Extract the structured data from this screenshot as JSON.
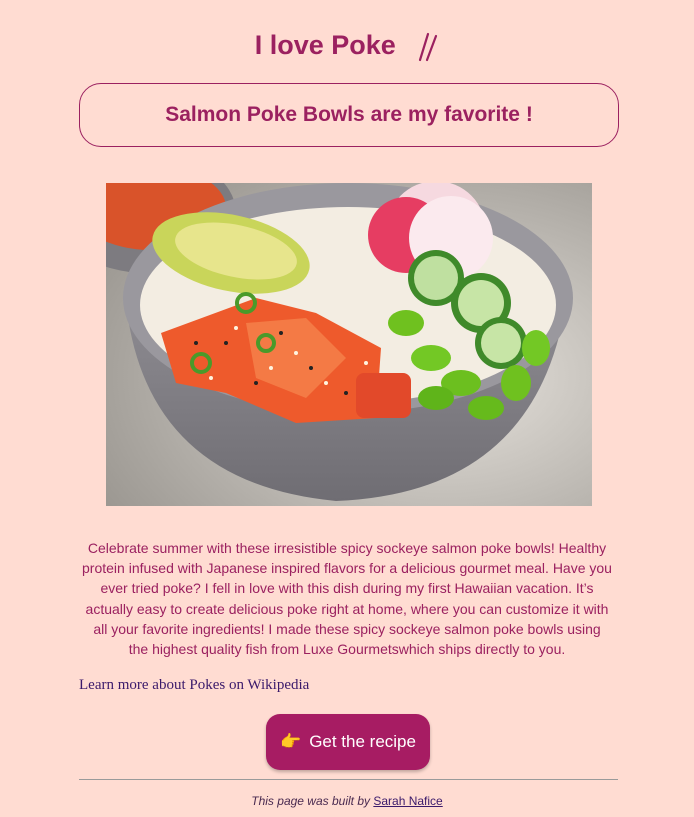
{
  "header": {
    "title": "I love Poke",
    "icon": "chopsticks-icon"
  },
  "subtitle": "Salmon Poke Bowls are my favorite !",
  "hero_image": {
    "subject": "salmon poke bowl"
  },
  "description": "Celebrate summer with these irresistible spicy sockeye salmon poke bowls! Healthy protein infused with Japanese inspired flavors for a delicious gourmet meal. Have you ever tried poke? I fell in love with this dish during my first Hawaiian vacation. It’s actually easy to create delicious poke right at home, where you can customize it with all your favorite ingredients! I made these spicy sockeye salmon poke bowls using the highest quality fish from Luxe Gourmetswhich ships directly to you.",
  "wiki_link": "Learn more about Pokes on Wikipedia",
  "cta": {
    "emoji": "👉",
    "label": "Get the recipe"
  },
  "footer": {
    "prefix": "This page was built by",
    "author": "Sarah Nafice"
  },
  "colors": {
    "background": "#ffdcd2",
    "accent": "#9b2160",
    "button": "#a71c63"
  }
}
